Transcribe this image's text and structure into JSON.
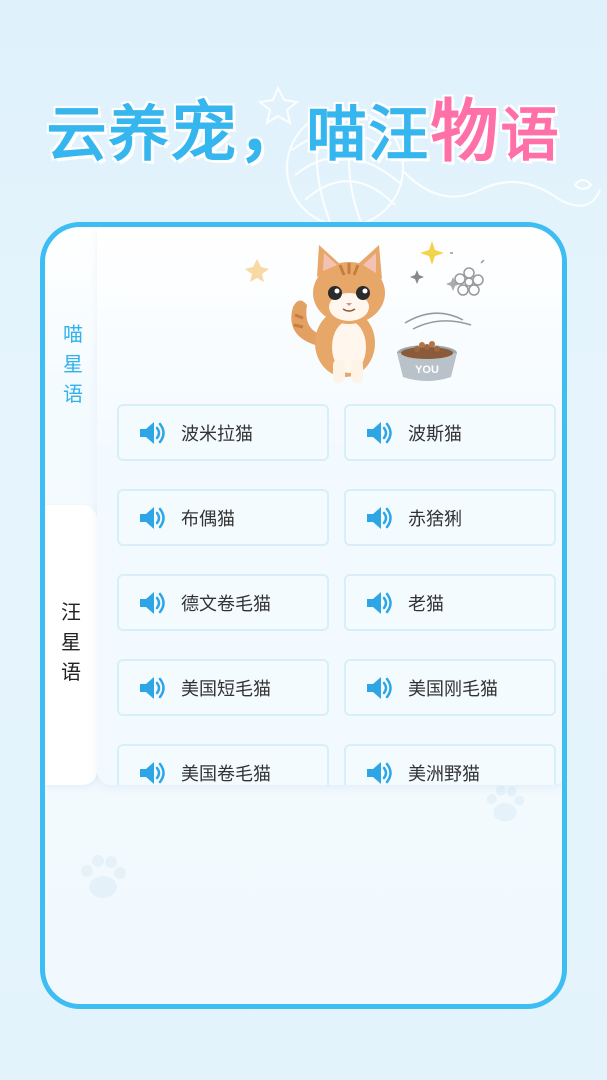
{
  "headline": {
    "part1": "云养",
    "part2": "宠，",
    "part3": "喵汪",
    "part4": "物",
    "part5": "语"
  },
  "tabs": [
    {
      "label": "喵\n星\n语",
      "chars": [
        "喵",
        "星",
        "语"
      ],
      "active": true
    },
    {
      "label": "汪\n星\n语",
      "chars": [
        "汪",
        "星",
        "语"
      ],
      "active": false
    }
  ],
  "hero": {
    "bowl_label": "YOU"
  },
  "breeds": [
    {
      "name": "波米拉猫"
    },
    {
      "name": "波斯猫"
    },
    {
      "name": "布偶猫"
    },
    {
      "name": "赤猞猁"
    },
    {
      "name": "德文卷毛猫"
    },
    {
      "name": "老猫"
    },
    {
      "name": "美国短毛猫"
    },
    {
      "name": "美国刚毛猫"
    },
    {
      "name": "美国卷毛猫"
    },
    {
      "name": "美洲野猫"
    }
  ],
  "colors": {
    "accent": "#3ebdf3",
    "pink": "#ff6fa8",
    "speaker": "#2ea6e6"
  },
  "icons": {
    "breed_icon": "speaker-icon"
  }
}
